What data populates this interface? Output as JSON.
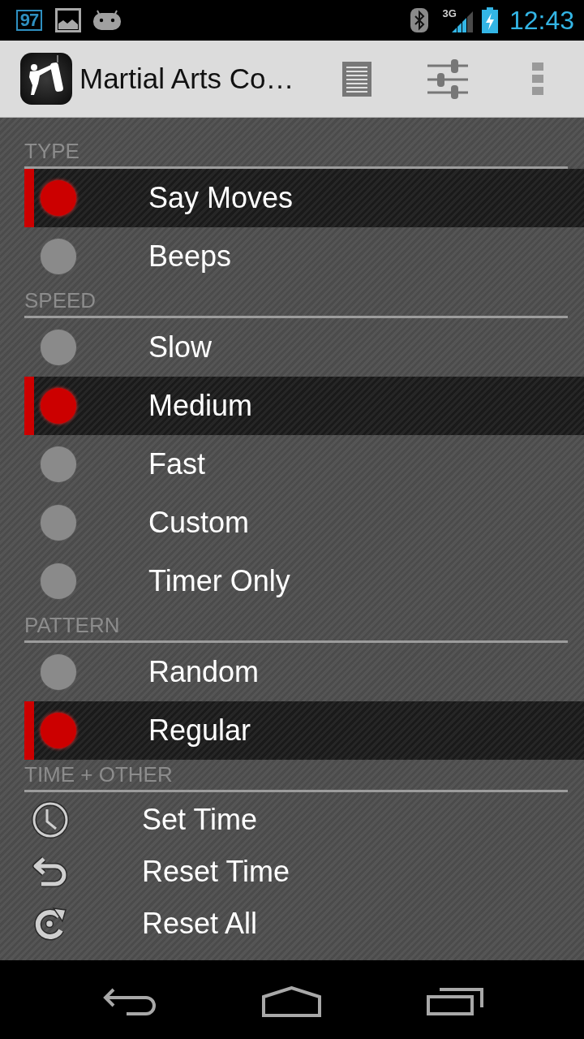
{
  "status_bar": {
    "notification": "97",
    "network": "3G",
    "time": "12:43"
  },
  "action_bar": {
    "title": "Martial Arts Co…"
  },
  "sections": [
    {
      "title": "TYPE",
      "items": [
        {
          "kind": "radio",
          "label": "Say Moves",
          "selected": true
        },
        {
          "kind": "radio",
          "label": "Beeps",
          "selected": false
        }
      ]
    },
    {
      "title": "SPEED",
      "items": [
        {
          "kind": "radio",
          "label": "Slow",
          "selected": false
        },
        {
          "kind": "radio",
          "label": "Medium",
          "selected": true
        },
        {
          "kind": "radio",
          "label": "Fast",
          "selected": false
        },
        {
          "kind": "radio",
          "label": "Custom",
          "selected": false
        },
        {
          "kind": "radio",
          "label": "Timer Only",
          "selected": false
        }
      ]
    },
    {
      "title": "PATTERN",
      "items": [
        {
          "kind": "radio",
          "label": "Random",
          "selected": false
        },
        {
          "kind": "radio",
          "label": "Regular",
          "selected": true
        }
      ]
    },
    {
      "title": "TIME + OTHER",
      "items": [
        {
          "kind": "action",
          "label": "Set Time"
        },
        {
          "kind": "action",
          "label": "Reset Time"
        },
        {
          "kind": "action",
          "label": "Reset All"
        }
      ]
    }
  ]
}
